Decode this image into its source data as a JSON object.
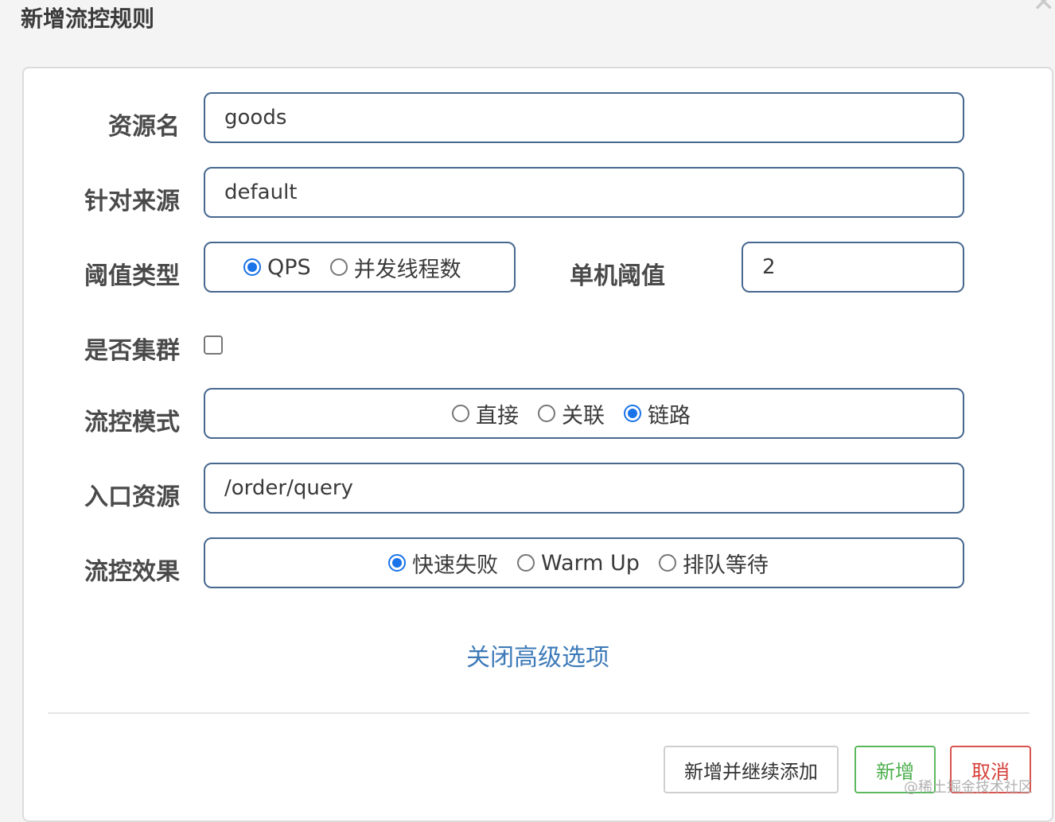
{
  "dialog": {
    "title": "新增流控规则"
  },
  "form": {
    "resource_name": {
      "label": "资源名",
      "value": "goods"
    },
    "limit_app": {
      "label": "针对来源",
      "value": "default"
    },
    "threshold_type": {
      "label": "阈值类型",
      "options": [
        {
          "label": "QPS",
          "checked": true
        },
        {
          "label": "并发线程数",
          "checked": false
        }
      ]
    },
    "single_threshold": {
      "label": "单机阈值",
      "value": "2"
    },
    "cluster": {
      "label": "是否集群",
      "checked": false
    },
    "control_mode": {
      "label": "流控模式",
      "options": [
        {
          "label": "直接",
          "checked": false
        },
        {
          "label": "关联",
          "checked": false
        },
        {
          "label": "链路",
          "checked": true
        }
      ]
    },
    "entry_resource": {
      "label": "入口资源",
      "value": "/order/query"
    },
    "control_effect": {
      "label": "流控效果",
      "options": [
        {
          "label": "快速失败",
          "checked": true
        },
        {
          "label": "Warm Up",
          "checked": false
        },
        {
          "label": "排队等待",
          "checked": false
        }
      ]
    }
  },
  "advanced_link": "关闭高级选项",
  "buttons": {
    "add_continue": "新增并继续添加",
    "add": "新增",
    "cancel": "取消"
  },
  "watermark": "@稀土掘金技术社区",
  "colors": {
    "accent": "#1a73e8",
    "field_border": "#47688f",
    "link": "#3d7ab8",
    "add": "#5cb85c",
    "cancel": "#d9534f"
  }
}
